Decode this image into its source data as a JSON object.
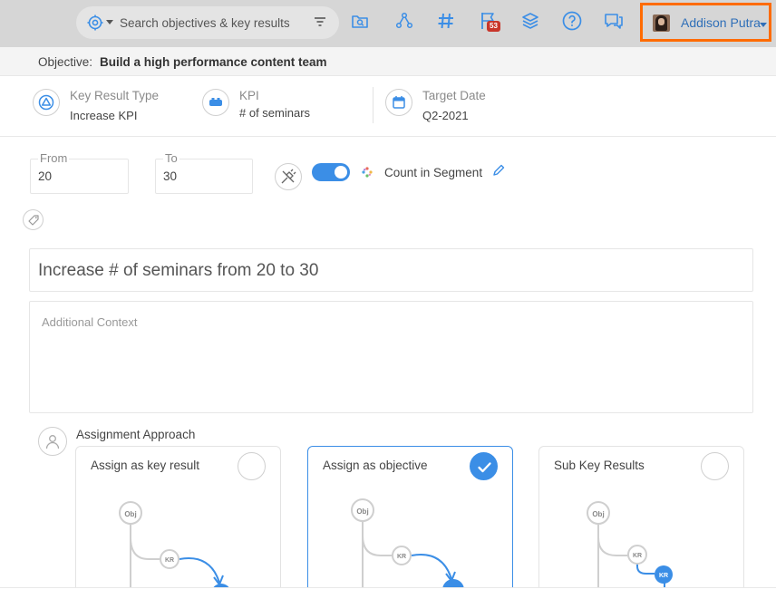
{
  "topbar": {
    "search_placeholder": "Search objectives & key results",
    "icons": [
      "target-icon",
      "filter-icon",
      "folder-search-icon",
      "hierarchy-icon",
      "hashtag-icon",
      "flag-icon",
      "layers-icon",
      "help-icon",
      "chat-icon"
    ],
    "flag_badge": "53",
    "user_name": "Addison Putra",
    "highlight_color": "#ff6b00"
  },
  "objective": {
    "prefix": "Objective:",
    "title": "Build a high performance content team"
  },
  "meta": {
    "kr_type_label": "Key Result Type",
    "kr_type_value": "Increase KPI",
    "kpi_label": "KPI",
    "kpi_value": "# of seminars",
    "target_label": "Target Date",
    "target_value": "Q2-2021"
  },
  "range": {
    "from_label": "From",
    "from_value": "20",
    "to_label": "To",
    "to_value": "30",
    "toggle_on": true,
    "segment_label": "Count in Segment"
  },
  "kr_title": "Increase # of seminars from 20 to 30",
  "context_placeholder": "Additional Context",
  "assignment": {
    "label": "Assignment Approach",
    "cards": [
      {
        "title": "Assign as key result",
        "selected": false
      },
      {
        "title": "Assign as objective",
        "selected": true
      },
      {
        "title": "Sub Key Results",
        "selected": false
      }
    ],
    "node_obj": "Obj",
    "node_kr": "KR"
  },
  "colors": {
    "accent": "#3b8ee6",
    "link": "#2f6fb8",
    "badge": "#c8362b"
  }
}
